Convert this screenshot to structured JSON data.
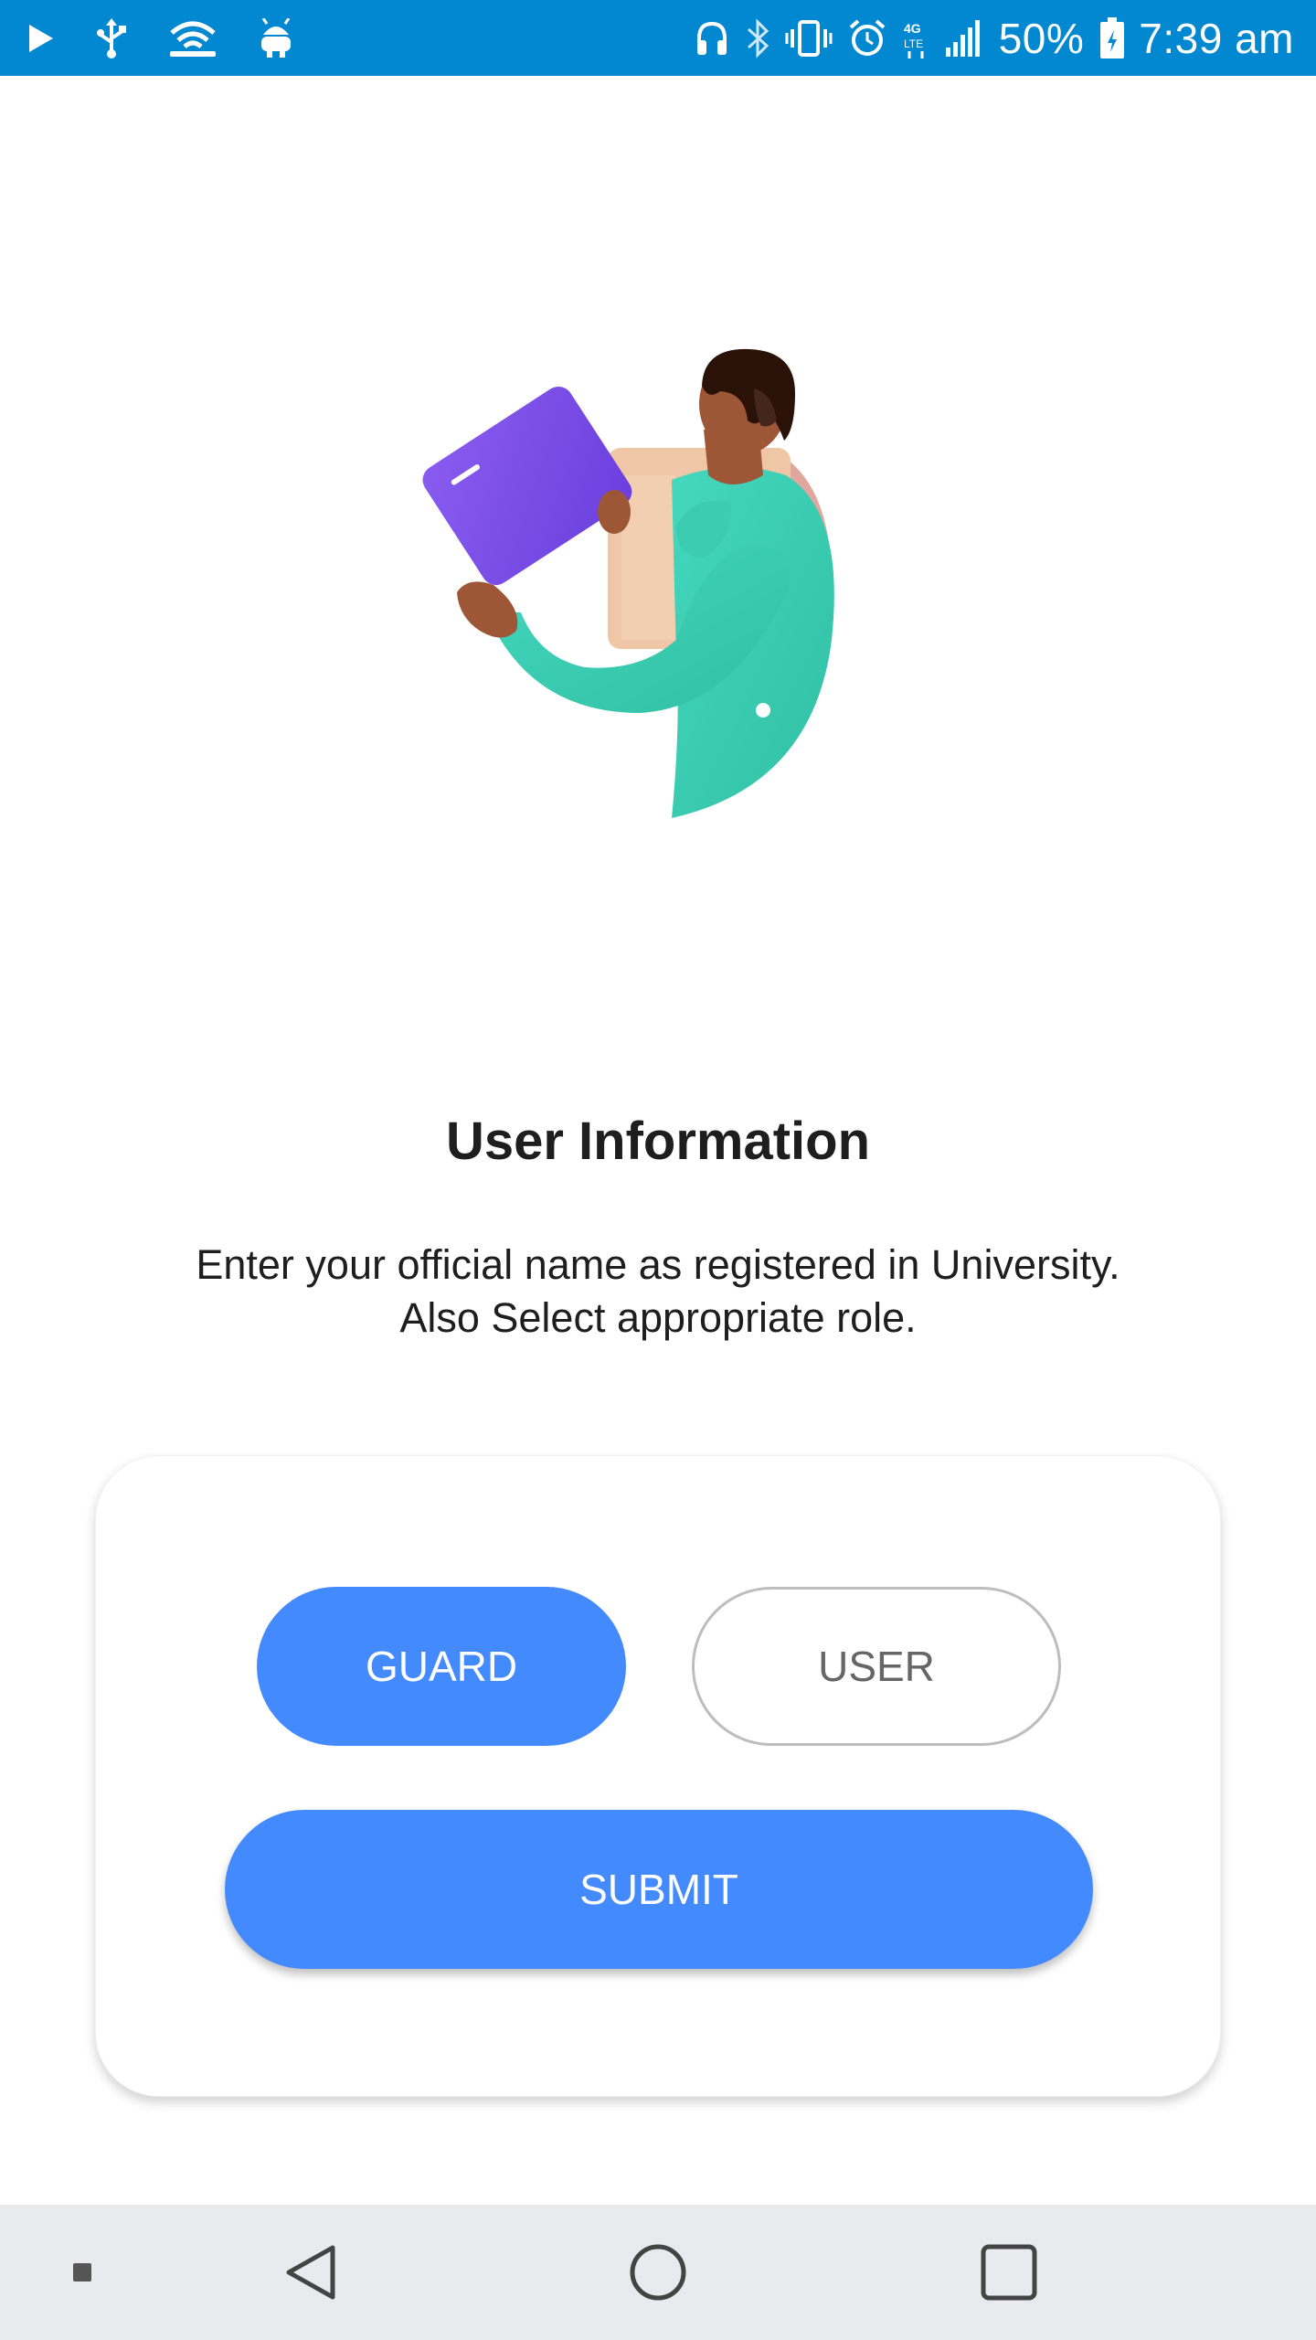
{
  "status_bar": {
    "battery_percent": "50%",
    "time": "7:39 am",
    "left_icons": [
      "play-icon",
      "usb-icon",
      "wifi-icon",
      "android-debug-icon"
    ],
    "right_icons": [
      "headphones-icon",
      "bluetooth-icon",
      "vibrate-icon",
      "alarm-icon",
      "4g-lte-icon",
      "signal-icon",
      "battery-icon"
    ],
    "background_color": "#0288d1"
  },
  "main": {
    "title": "User Information",
    "description_line1": "Enter your official name as registered in University.",
    "description_line2": "Also Select appropriate role."
  },
  "role_card": {
    "guard_label": "GUARD",
    "user_label": "USER",
    "submit_label": "SUBMIT",
    "selected_role": "GUARD",
    "accent_color": "#448aff"
  },
  "nav_bar": {
    "items": [
      "recent-dot-icon",
      "back-icon",
      "home-icon",
      "overview-icon"
    ]
  }
}
